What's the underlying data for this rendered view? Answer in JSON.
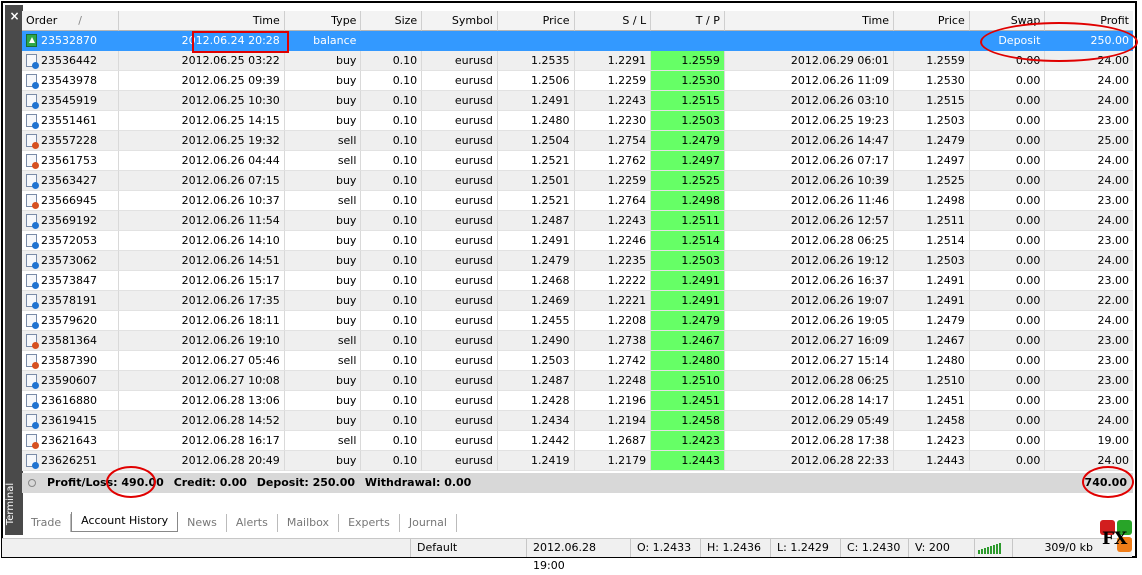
{
  "panel": {
    "close_label": "×",
    "side_label": "Terminal"
  },
  "columns": [
    "Order",
    "Time",
    "Type",
    "Size",
    "Symbol",
    "Price",
    "S / L",
    "T / P",
    "Time",
    "Price",
    "Swap",
    "Profit"
  ],
  "sort_indicator": "/",
  "rows": [
    {
      "order": "23532870",
      "time": "2012.06.24 20:28",
      "type": "balance",
      "size": "",
      "symbol": "",
      "price": "",
      "sl": "",
      "tp": "",
      "time2": "",
      "price2": "",
      "swap": "Deposit",
      "profit": "250.00",
      "icon": "deposit",
      "selected": true
    },
    {
      "order": "23536442",
      "time": "2012.06.25 03:22",
      "type": "buy",
      "size": "0.10",
      "symbol": "eurusd",
      "price": "1.2535",
      "sl": "1.2291",
      "tp": "1.2559",
      "time2": "2012.06.29 06:01",
      "price2": "1.2559",
      "swap": "0.00",
      "profit": "24.00",
      "icon": "buy"
    },
    {
      "order": "23543978",
      "time": "2012.06.25 09:39",
      "type": "buy",
      "size": "0.10",
      "symbol": "eurusd",
      "price": "1.2506",
      "sl": "1.2259",
      "tp": "1.2530",
      "time2": "2012.06.26 11:09",
      "price2": "1.2530",
      "swap": "0.00",
      "profit": "24.00",
      "icon": "buy"
    },
    {
      "order": "23545919",
      "time": "2012.06.25 10:30",
      "type": "buy",
      "size": "0.10",
      "symbol": "eurusd",
      "price": "1.2491",
      "sl": "1.2243",
      "tp": "1.2515",
      "time2": "2012.06.26 03:10",
      "price2": "1.2515",
      "swap": "0.00",
      "profit": "24.00",
      "icon": "buy"
    },
    {
      "order": "23551461",
      "time": "2012.06.25 14:15",
      "type": "buy",
      "size": "0.10",
      "symbol": "eurusd",
      "price": "1.2480",
      "sl": "1.2230",
      "tp": "1.2503",
      "time2": "2012.06.25 19:23",
      "price2": "1.2503",
      "swap": "0.00",
      "profit": "23.00",
      "icon": "buy"
    },
    {
      "order": "23557228",
      "time": "2012.06.25 19:32",
      "type": "sell",
      "size": "0.10",
      "symbol": "eurusd",
      "price": "1.2504",
      "sl": "1.2754",
      "tp": "1.2479",
      "time2": "2012.06.26 14:47",
      "price2": "1.2479",
      "swap": "0.00",
      "profit": "25.00",
      "icon": "sell"
    },
    {
      "order": "23561753",
      "time": "2012.06.26 04:44",
      "type": "sell",
      "size": "0.10",
      "symbol": "eurusd",
      "price": "1.2521",
      "sl": "1.2762",
      "tp": "1.2497",
      "time2": "2012.06.26 07:17",
      "price2": "1.2497",
      "swap": "0.00",
      "profit": "24.00",
      "icon": "sell"
    },
    {
      "order": "23563427",
      "time": "2012.06.26 07:15",
      "type": "buy",
      "size": "0.10",
      "symbol": "eurusd",
      "price": "1.2501",
      "sl": "1.2259",
      "tp": "1.2525",
      "time2": "2012.06.26 10:39",
      "price2": "1.2525",
      "swap": "0.00",
      "profit": "24.00",
      "icon": "buy"
    },
    {
      "order": "23566945",
      "time": "2012.06.26 10:37",
      "type": "sell",
      "size": "0.10",
      "symbol": "eurusd",
      "price": "1.2521",
      "sl": "1.2764",
      "tp": "1.2498",
      "time2": "2012.06.26 11:46",
      "price2": "1.2498",
      "swap": "0.00",
      "profit": "23.00",
      "icon": "sell"
    },
    {
      "order": "23569192",
      "time": "2012.06.26 11:54",
      "type": "buy",
      "size": "0.10",
      "symbol": "eurusd",
      "price": "1.2487",
      "sl": "1.2243",
      "tp": "1.2511",
      "time2": "2012.06.26 12:57",
      "price2": "1.2511",
      "swap": "0.00",
      "profit": "24.00",
      "icon": "buy"
    },
    {
      "order": "23572053",
      "time": "2012.06.26 14:10",
      "type": "buy",
      "size": "0.10",
      "symbol": "eurusd",
      "price": "1.2491",
      "sl": "1.2246",
      "tp": "1.2514",
      "time2": "2012.06.28 06:25",
      "price2": "1.2514",
      "swap": "0.00",
      "profit": "23.00",
      "icon": "buy"
    },
    {
      "order": "23573062",
      "time": "2012.06.26 14:51",
      "type": "buy",
      "size": "0.10",
      "symbol": "eurusd",
      "price": "1.2479",
      "sl": "1.2235",
      "tp": "1.2503",
      "time2": "2012.06.26 19:12",
      "price2": "1.2503",
      "swap": "0.00",
      "profit": "24.00",
      "icon": "buy"
    },
    {
      "order": "23573847",
      "time": "2012.06.26 15:17",
      "type": "buy",
      "size": "0.10",
      "symbol": "eurusd",
      "price": "1.2468",
      "sl": "1.2222",
      "tp": "1.2491",
      "time2": "2012.06.26 16:37",
      "price2": "1.2491",
      "swap": "0.00",
      "profit": "23.00",
      "icon": "buy"
    },
    {
      "order": "23578191",
      "time": "2012.06.26 17:35",
      "type": "buy",
      "size": "0.10",
      "symbol": "eurusd",
      "price": "1.2469",
      "sl": "1.2221",
      "tp": "1.2491",
      "time2": "2012.06.26 19:07",
      "price2": "1.2491",
      "swap": "0.00",
      "profit": "22.00",
      "icon": "buy"
    },
    {
      "order": "23579620",
      "time": "2012.06.26 18:11",
      "type": "buy",
      "size": "0.10",
      "symbol": "eurusd",
      "price": "1.2455",
      "sl": "1.2208",
      "tp": "1.2479",
      "time2": "2012.06.26 19:05",
      "price2": "1.2479",
      "swap": "0.00",
      "profit": "24.00",
      "icon": "buy"
    },
    {
      "order": "23581364",
      "time": "2012.06.26 19:10",
      "type": "sell",
      "size": "0.10",
      "symbol": "eurusd",
      "price": "1.2490",
      "sl": "1.2738",
      "tp": "1.2467",
      "time2": "2012.06.27 16:09",
      "price2": "1.2467",
      "swap": "0.00",
      "profit": "23.00",
      "icon": "sell"
    },
    {
      "order": "23587390",
      "time": "2012.06.27 05:46",
      "type": "sell",
      "size": "0.10",
      "symbol": "eurusd",
      "price": "1.2503",
      "sl": "1.2742",
      "tp": "1.2480",
      "time2": "2012.06.27 15:14",
      "price2": "1.2480",
      "swap": "0.00",
      "profit": "23.00",
      "icon": "sell"
    },
    {
      "order": "23590607",
      "time": "2012.06.27 10:08",
      "type": "buy",
      "size": "0.10",
      "symbol": "eurusd",
      "price": "1.2487",
      "sl": "1.2248",
      "tp": "1.2510",
      "time2": "2012.06.28 06:25",
      "price2": "1.2510",
      "swap": "0.00",
      "profit": "23.00",
      "icon": "buy"
    },
    {
      "order": "23616880",
      "time": "2012.06.28 13:06",
      "type": "buy",
      "size": "0.10",
      "symbol": "eurusd",
      "price": "1.2428",
      "sl": "1.2196",
      "tp": "1.2451",
      "time2": "2012.06.28 14:17",
      "price2": "1.2451",
      "swap": "0.00",
      "profit": "23.00",
      "icon": "buy"
    },
    {
      "order": "23619415",
      "time": "2012.06.28 14:52",
      "type": "buy",
      "size": "0.10",
      "symbol": "eurusd",
      "price": "1.2434",
      "sl": "1.2194",
      "tp": "1.2458",
      "time2": "2012.06.29 05:49",
      "price2": "1.2458",
      "swap": "0.00",
      "profit": "24.00",
      "icon": "buy"
    },
    {
      "order": "23621643",
      "time": "2012.06.28 16:17",
      "type": "sell",
      "size": "0.10",
      "symbol": "eurusd",
      "price": "1.2442",
      "sl": "1.2687",
      "tp": "1.2423",
      "time2": "2012.06.28 17:38",
      "price2": "1.2423",
      "swap": "0.00",
      "profit": "19.00",
      "icon": "sell"
    },
    {
      "order": "23626251",
      "time": "2012.06.28 20:49",
      "type": "buy",
      "size": "0.10",
      "symbol": "eurusd",
      "price": "1.2419",
      "sl": "1.2179",
      "tp": "1.2443",
      "time2": "2012.06.28 22:33",
      "price2": "1.2443",
      "swap": "0.00",
      "profit": "24.00",
      "icon": "buy"
    }
  ],
  "summary": {
    "profit_loss_label": "Profit/Loss:",
    "profit_loss_value": "490.00",
    "credit": "Credit: 0.00",
    "deposit": "Deposit: 250.00",
    "withdrawal": "Withdrawal: 0.00",
    "total": "740.00"
  },
  "tabs": [
    "Trade",
    "Account History",
    "News",
    "Alerts",
    "Mailbox",
    "Experts",
    "Journal"
  ],
  "active_tab": "Account History",
  "status": {
    "profile": "Default",
    "datetime": "2012.06.28 19:00",
    "open": "O: 1.2433",
    "high": "H: 1.2436",
    "low": "L: 1.2429",
    "close": "C: 1.2430",
    "volume": "V: 200",
    "traffic": "309/0 kb"
  },
  "logo": {
    "text": "FX"
  },
  "colors": {
    "selected_row": "#3399ff",
    "tp_cell": "#66ff66",
    "highlight": "#e00000",
    "side_panel": "#4a4a4a"
  }
}
